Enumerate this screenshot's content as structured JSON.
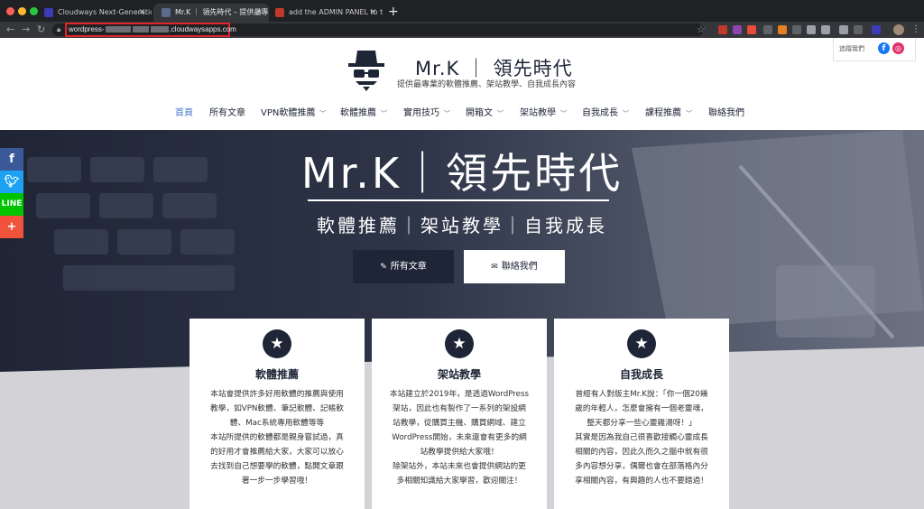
{
  "browser": {
    "tabs": [
      {
        "title": "Cloudways Next-Generation C",
        "favicon_color": "#3d3bb5",
        "active": false
      },
      {
        "title": "Mr.K ｜ 領先時代 – 提供最專業的",
        "favicon_color": "#5a6b8c",
        "active": true
      },
      {
        "title": "add the ADMIN PANEL to the C",
        "favicon_color": "#c0392b",
        "active": false
      }
    ],
    "url_prefix": "wordpress-",
    "url_suffix": ".cloudwaysapps.com"
  },
  "header": {
    "follow_label": "追蹤我們",
    "site_title": "Mr.K ｜ 領先時代",
    "tagline": "提供最專業的軟體推薦、架站教學、自我成長內容",
    "nav": [
      {
        "label": "首頁",
        "active": true,
        "dropdown": false
      },
      {
        "label": "所有文章",
        "active": false,
        "dropdown": false
      },
      {
        "label": "VPN軟體推薦",
        "active": false,
        "dropdown": true
      },
      {
        "label": "軟體推薦",
        "active": false,
        "dropdown": true
      },
      {
        "label": "實用技巧",
        "active": false,
        "dropdown": true
      },
      {
        "label": "開箱文",
        "active": false,
        "dropdown": true
      },
      {
        "label": "架站教學",
        "active": false,
        "dropdown": true
      },
      {
        "label": "自我成長",
        "active": false,
        "dropdown": true
      },
      {
        "label": "課程推薦",
        "active": false,
        "dropdown": true
      },
      {
        "label": "聯絡我們",
        "active": false,
        "dropdown": false
      }
    ]
  },
  "share": [
    {
      "icon": "facebook-icon",
      "glyph": "f",
      "color": "#3b5998"
    },
    {
      "icon": "twitter-icon",
      "glyph": "t",
      "color": "#1da1f2"
    },
    {
      "icon": "line-icon",
      "glyph": "L",
      "color": "#00c300"
    },
    {
      "icon": "more-share-icon",
      "glyph": "+",
      "color": "#f0523b"
    }
  ],
  "hero": {
    "title": "Mr.K｜領先時代",
    "subtitle": "軟體推薦｜架站教學｜自我成長",
    "btn_posts": "所有文章",
    "btn_contact": "聯絡我們"
  },
  "cards": [
    {
      "title": "軟體推薦",
      "body": "本站會提供許多好用軟體的推薦與使用\n教學，如VPN軟體、筆記軟體、記帳軟\n體、Mac系統專用軟體等等\n本站所提供的軟體都是親身嘗試過，真\n的好用才會推薦給大家，大家可以放心\n去找到自己想要學的軟體，點開文章跟\n著一步一步學習哦！"
    },
    {
      "title": "架站教學",
      "body": "本站建立於2019年，是透過WordPress\n架站，因此也有製作了一系列的架設網\n站教學，從購買主機、購買網域、建立\nWordPress開始，未來還會有更多的網\n站教學提供給大家哦！\n除架站外，本站未來也會提供網站的更\n多相關知識給大家學習，歡迎關注！"
    },
    {
      "title": "自我成長",
      "body": "曾經有人對版主Mr.K說：「你一個20幾\n歲的年輕人，怎麼會擁有一個老靈魂，\n整天都分享一些心靈雞湯呀！」\n其實是因為我自己很喜歡接觸心靈成長\n相關的內容，因此久而久之腦中就有很\n多內容想分享，偶爾也會在部落格內分\n享相關內容，有興趣的人也不要錯過！"
    }
  ],
  "colors": {
    "navy": "#1e2537",
    "nav_active": "#4a78c8",
    "chrome_dark": "#202124",
    "url_highlight": "#e0252b"
  }
}
